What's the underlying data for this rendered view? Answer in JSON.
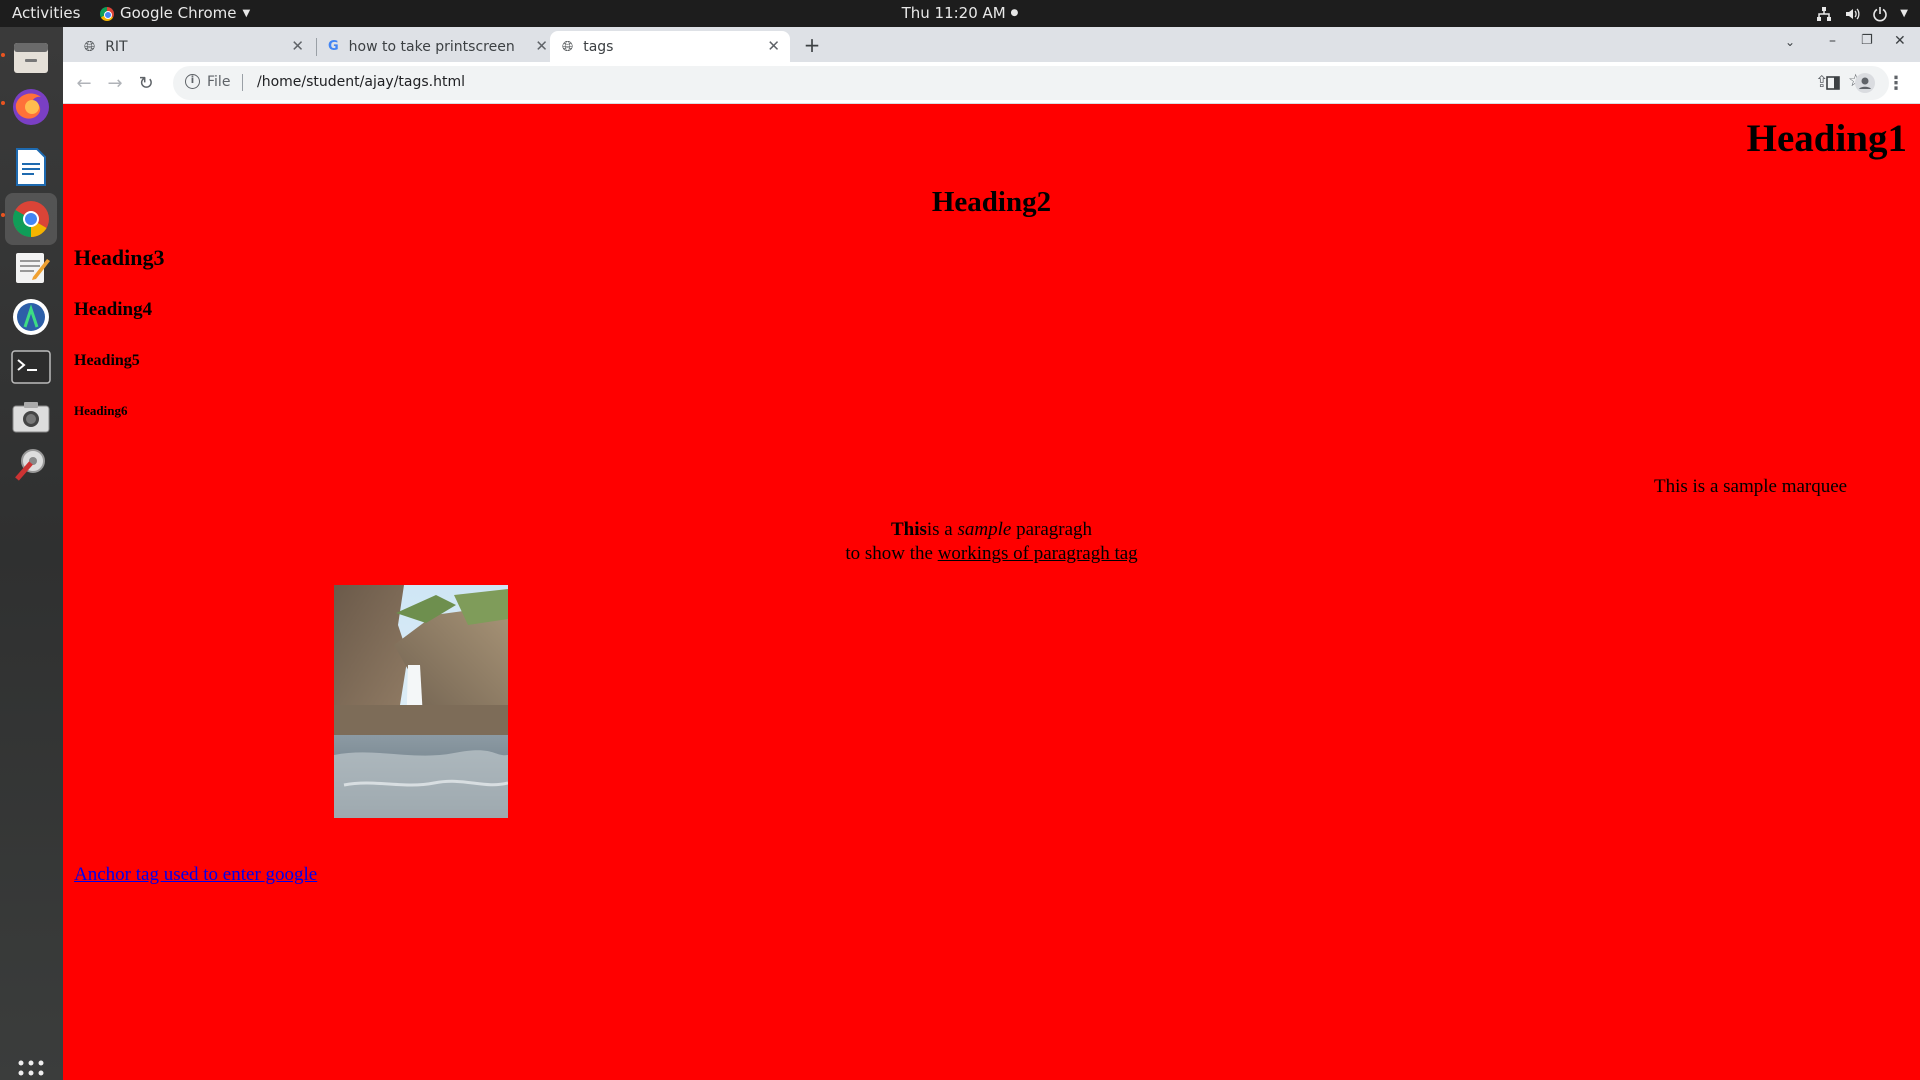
{
  "topbar": {
    "activities": "Activities",
    "app_name": "Google Chrome",
    "clock": "Thu 11:20 AM"
  },
  "dock": {
    "items": [
      {
        "name": "Files"
      },
      {
        "name": "Firefox"
      },
      {
        "name": "LibreOffice Writer"
      },
      {
        "name": "Google Chrome"
      },
      {
        "name": "Text Editor"
      },
      {
        "name": "Android Studio"
      },
      {
        "name": "Terminal"
      },
      {
        "name": "Screenshot"
      },
      {
        "name": "Settings"
      },
      {
        "name": "Show Applications"
      }
    ]
  },
  "browser": {
    "tabs": [
      {
        "title": "RIT",
        "active": false
      },
      {
        "title": "how to take printscreen i",
        "active": false
      },
      {
        "title": "tags",
        "active": true
      }
    ],
    "url_scheme_label": "File",
    "url": "/home/student/ajay/tags.html"
  },
  "page": {
    "h1": "Heading1",
    "h2": "Heading2",
    "h3": "Heading3",
    "h4": "Heading4",
    "h5": "Heading5",
    "h6": "Heading6",
    "marquee": "This is a sample marquee",
    "para_bold": "This",
    "para_text1": "is a ",
    "para_italic": "sample",
    "para_text2": " paragragh",
    "para_line2_prefix": "to show the ",
    "para_underline": "workings of paragragh tag",
    "anchor": "Anchor tag used to enter google "
  },
  "colors": {
    "page_background": "#ff0000",
    "link": "#0000ee",
    "accent": "#e95420"
  }
}
